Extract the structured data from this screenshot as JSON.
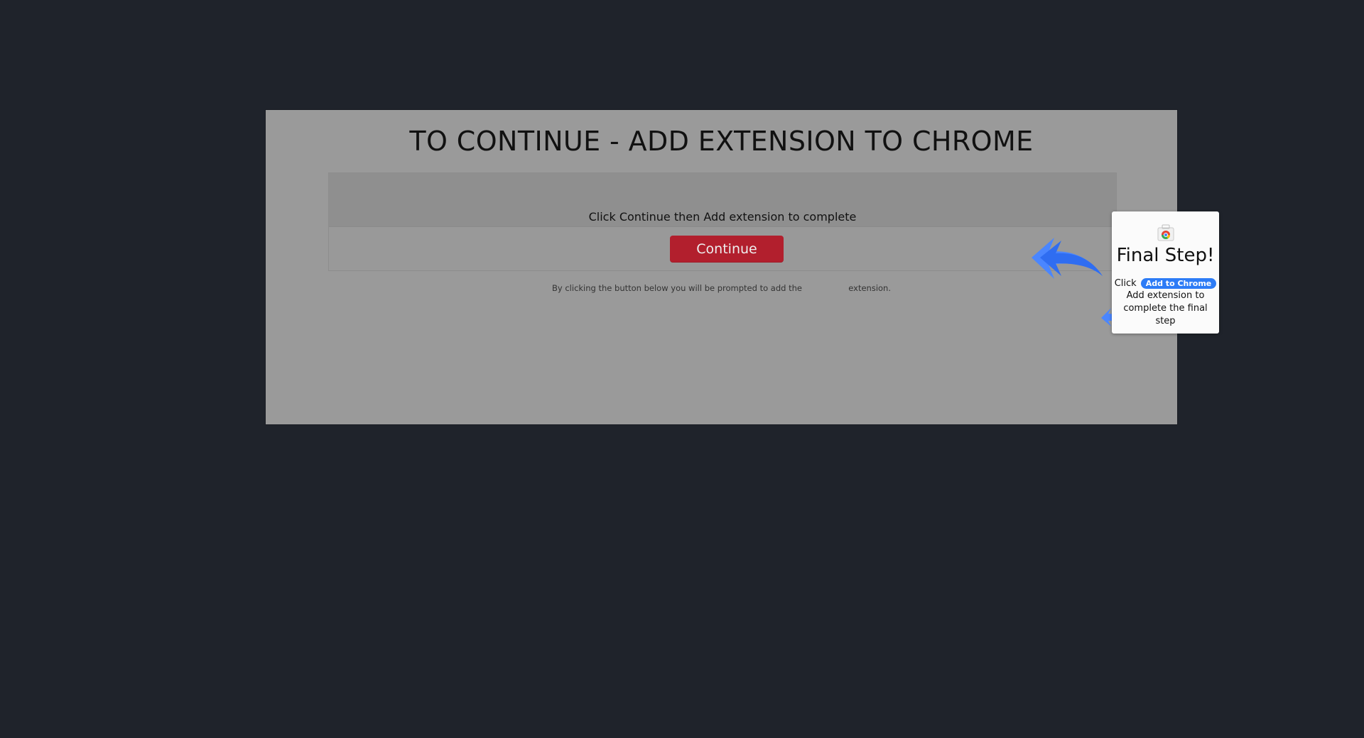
{
  "page": {
    "title": "TO CONTINUE - ADD EXTENSION TO CHROME"
  },
  "card": {
    "instruction": "Click Continue then Add extension to complete",
    "button_label": "Continue"
  },
  "disclaimer": {
    "before": "By clicking the button below you will be prompted to add the",
    "after": "extension."
  },
  "popup": {
    "title": "Final Step!",
    "click_label": "Click",
    "button_label": "Add to Chrome",
    "detail": "Add extension to complete the final step"
  },
  "icons": {
    "main_arrow": "back-arrow-icon",
    "secondary_arrow": "back-arrow-icon",
    "store": "chrome-webstore-icon"
  },
  "colors": {
    "background": "#1f232b",
    "panel": "#9a9a9a",
    "primary": "#b21f2d",
    "accent": "#2d7cf6"
  }
}
